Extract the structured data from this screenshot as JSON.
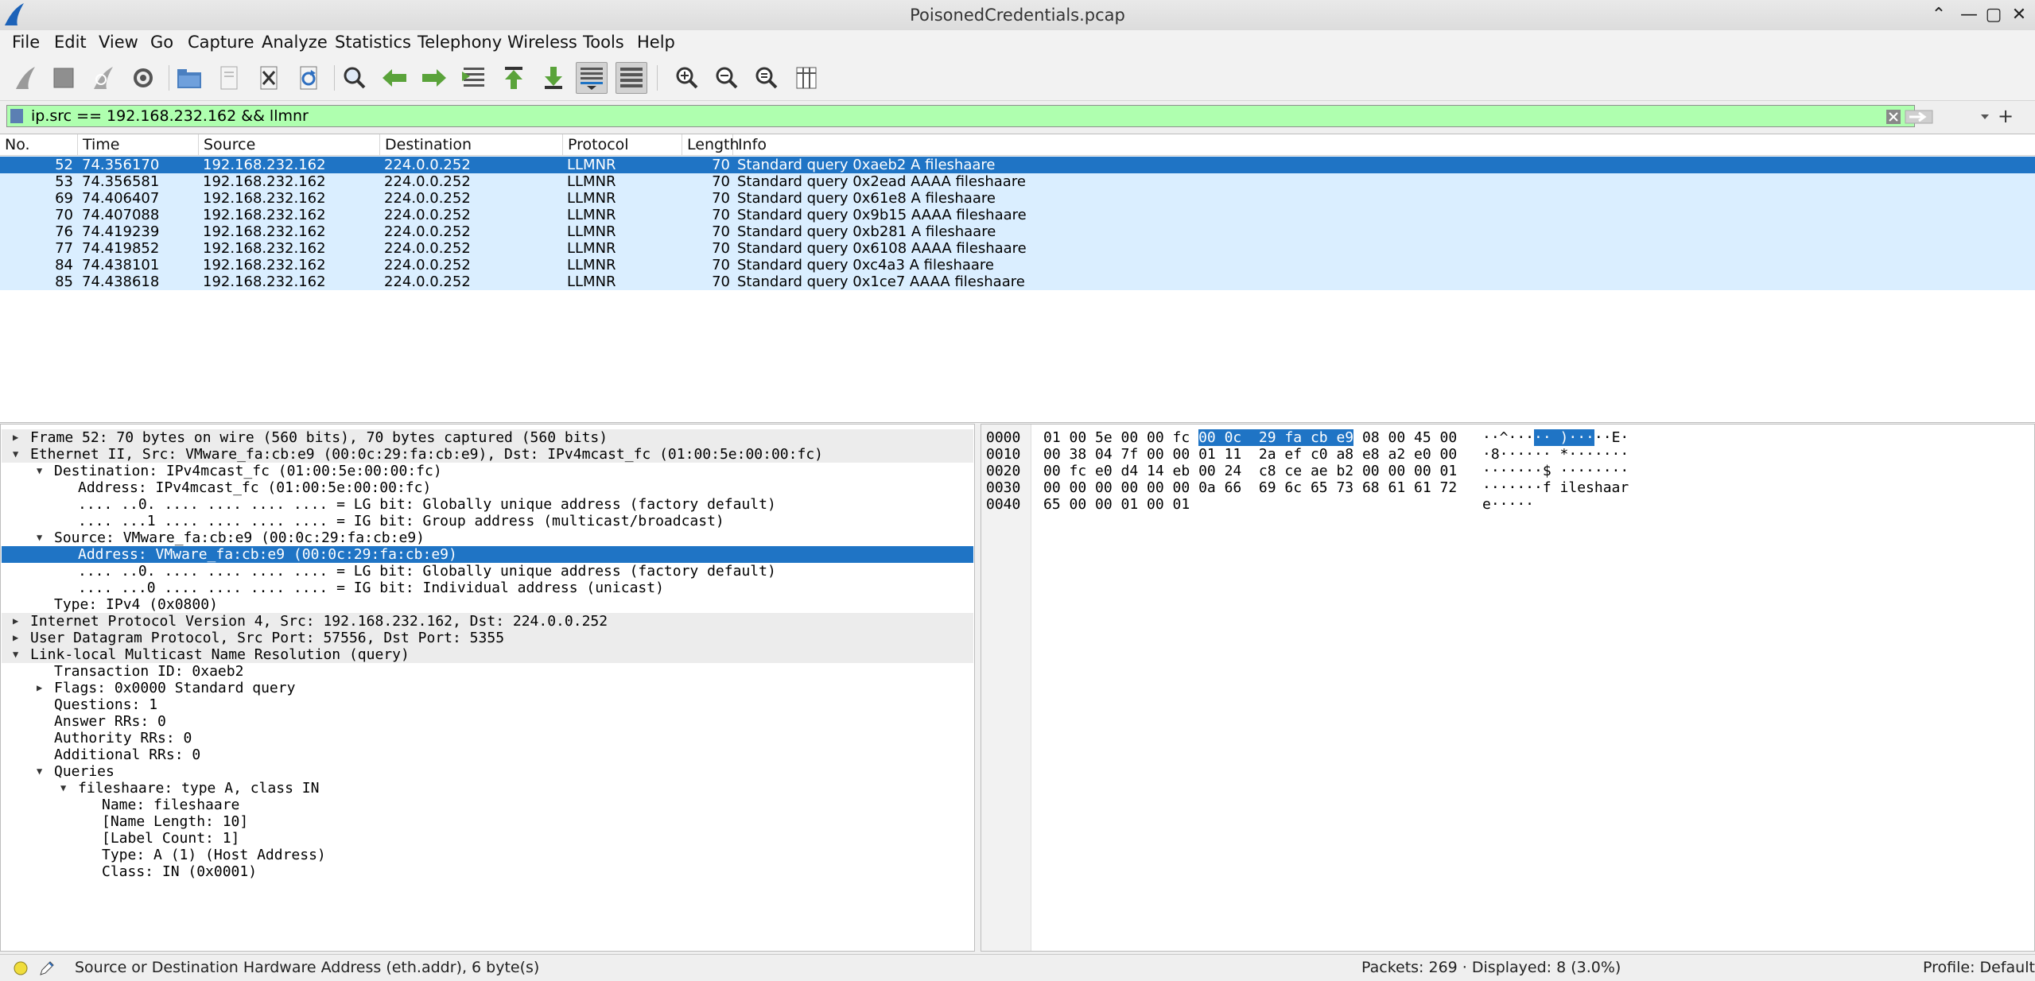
{
  "window": {
    "title": "PoisonedCredentials.pcap",
    "controls": [
      "⌃",
      "—",
      "▢",
      "✕"
    ]
  },
  "menu": [
    "File",
    "Edit",
    "View",
    "Go",
    "Capture",
    "Analyze",
    "Statistics",
    "Telephony",
    "Wireless",
    "Tools",
    "Help"
  ],
  "toolbar": {
    "icons": [
      "shark-fin-start-icon",
      "stop-square-icon",
      "restart-fin-icon",
      "capture-options-gear-icon",
      "open-folder-icon",
      "save-file-icon",
      "close-file-icon",
      "reload-icon",
      "find-magnifier-icon",
      "go-back-arrow-icon",
      "go-forward-arrow-icon",
      "go-to-packet-icon",
      "first-packet-icon",
      "last-packet-icon",
      "autoscroll-icon",
      "colorize-icon",
      "zoom-in-icon",
      "zoom-out-icon",
      "normal-size-icon",
      "resize-columns-icon"
    ]
  },
  "filter": {
    "value": "ip.src == 192.168.232.162 && llmnr",
    "add_label": "+"
  },
  "packet_list": {
    "columns": [
      "No.",
      "Time",
      "Source",
      "Destination",
      "Protocol",
      "Length",
      "Info"
    ],
    "rows": [
      {
        "no": "52",
        "time": "74.356170",
        "src": "192.168.232.162",
        "dst": "224.0.0.252",
        "proto": "LLMNR",
        "len": "70",
        "info": "Standard query 0xaeb2 A fileshaare"
      },
      {
        "no": "53",
        "time": "74.356581",
        "src": "192.168.232.162",
        "dst": "224.0.0.252",
        "proto": "LLMNR",
        "len": "70",
        "info": "Standard query 0x2ead AAAA fileshaare"
      },
      {
        "no": "69",
        "time": "74.406407",
        "src": "192.168.232.162",
        "dst": "224.0.0.252",
        "proto": "LLMNR",
        "len": "70",
        "info": "Standard query 0x61e8 A fileshaare"
      },
      {
        "no": "70",
        "time": "74.407088",
        "src": "192.168.232.162",
        "dst": "224.0.0.252",
        "proto": "LLMNR",
        "len": "70",
        "info": "Standard query 0x9b15 AAAA fileshaare"
      },
      {
        "no": "76",
        "time": "74.419239",
        "src": "192.168.232.162",
        "dst": "224.0.0.252",
        "proto": "LLMNR",
        "len": "70",
        "info": "Standard query 0xb281 A fileshaare"
      },
      {
        "no": "77",
        "time": "74.419852",
        "src": "192.168.232.162",
        "dst": "224.0.0.252",
        "proto": "LLMNR",
        "len": "70",
        "info": "Standard query 0x6108 AAAA fileshaare"
      },
      {
        "no": "84",
        "time": "74.438101",
        "src": "192.168.232.162",
        "dst": "224.0.0.252",
        "proto": "LLMNR",
        "len": "70",
        "info": "Standard query 0xc4a3 A fileshaare"
      },
      {
        "no": "85",
        "time": "74.438618",
        "src": "192.168.232.162",
        "dst": "224.0.0.252",
        "proto": "LLMNR",
        "len": "70",
        "info": "Standard query 0x1ce7 AAAA fileshaare"
      }
    ]
  },
  "details": [
    {
      "level": 0,
      "arrow": "right",
      "text": "Frame 52: 70 bytes on wire (560 bits), 70 bytes captured (560 bits)"
    },
    {
      "level": 0,
      "arrow": "down",
      "text": "Ethernet II, Src: VMware_fa:cb:e9 (00:0c:29:fa:cb:e9), Dst: IPv4mcast_fc (01:00:5e:00:00:fc)"
    },
    {
      "level": 1,
      "arrow": "down",
      "text": "Destination: IPv4mcast_fc (01:00:5e:00:00:fc)"
    },
    {
      "level": 2,
      "arrow": "",
      "text": "Address: IPv4mcast_fc (01:00:5e:00:00:fc)"
    },
    {
      "level": 2,
      "arrow": "",
      "text": ".... ..0. .... .... .... .... = LG bit: Globally unique address (factory default)"
    },
    {
      "level": 2,
      "arrow": "",
      "text": ".... ...1 .... .... .... .... = IG bit: Group address (multicast/broadcast)"
    },
    {
      "level": 1,
      "arrow": "down",
      "text": "Source: VMware_fa:cb:e9 (00:0c:29:fa:cb:e9)"
    },
    {
      "level": 2,
      "arrow": "",
      "text": "Address: VMware_fa:cb:e9 (00:0c:29:fa:cb:e9)",
      "selected": true
    },
    {
      "level": 2,
      "arrow": "",
      "text": ".... ..0. .... .... .... .... = LG bit: Globally unique address (factory default)"
    },
    {
      "level": 2,
      "arrow": "",
      "text": ".... ...0 .... .... .... .... = IG bit: Individual address (unicast)"
    },
    {
      "level": 1,
      "arrow": "",
      "text": "Type: IPv4 (0x0800)"
    },
    {
      "level": 0,
      "arrow": "right",
      "text": "Internet Protocol Version 4, Src: 192.168.232.162, Dst: 224.0.0.252"
    },
    {
      "level": 0,
      "arrow": "right",
      "text": "User Datagram Protocol, Src Port: 57556, Dst Port: 5355"
    },
    {
      "level": 0,
      "arrow": "down",
      "text": "Link-local Multicast Name Resolution (query)"
    },
    {
      "level": 1,
      "arrow": "",
      "text": "Transaction ID: 0xaeb2"
    },
    {
      "level": 1,
      "arrow": "right",
      "text": "Flags: 0x0000 Standard query"
    },
    {
      "level": 1,
      "arrow": "",
      "text": "Questions: 1"
    },
    {
      "level": 1,
      "arrow": "",
      "text": "Answer RRs: 0"
    },
    {
      "level": 1,
      "arrow": "",
      "text": "Authority RRs: 0"
    },
    {
      "level": 1,
      "arrow": "",
      "text": "Additional RRs: 0"
    },
    {
      "level": 1,
      "arrow": "down",
      "text": "Queries"
    },
    {
      "level": 2,
      "arrow": "down",
      "text": "fileshaare: type A, class IN"
    },
    {
      "level": 3,
      "arrow": "",
      "text": "Name: fileshaare"
    },
    {
      "level": 3,
      "arrow": "",
      "text": "[Name Length: 10]"
    },
    {
      "level": 3,
      "arrow": "",
      "text": "[Label Count: 1]"
    },
    {
      "level": 3,
      "arrow": "",
      "text": "Type: A (1) (Host Address)"
    },
    {
      "level": 3,
      "arrow": "",
      "text": "Class: IN (0x0001)"
    }
  ],
  "bytes": [
    {
      "offset": "0000",
      "hex_pre": "01 00 5e 00 00 fc ",
      "hex_hl": "00 0c  29 fa cb e9",
      "hex_post": " 08 00 45 00",
      "ascii_pre": "··^···",
      "ascii_hl": "·· )···",
      "ascii_post": "··E·"
    },
    {
      "offset": "0010",
      "hex_pre": "00 38 04 7f 00 00 01 11  2a ef c0 a8 e8 a2 e0 00",
      "hex_hl": "",
      "hex_post": "",
      "ascii_pre": "·8······ *·······",
      "ascii_hl": "",
      "ascii_post": ""
    },
    {
      "offset": "0020",
      "hex_pre": "00 fc e0 d4 14 eb 00 24  c8 ce ae b2 00 00 00 01",
      "hex_hl": "",
      "hex_post": "",
      "ascii_pre": "·······$ ········",
      "ascii_hl": "",
      "ascii_post": ""
    },
    {
      "offset": "0030",
      "hex_pre": "00 00 00 00 00 00 0a 66  69 6c 65 73 68 61 61 72",
      "hex_hl": "",
      "hex_post": "",
      "ascii_pre": "·······f ileshaar",
      "ascii_hl": "",
      "ascii_post": ""
    },
    {
      "offset": "0040",
      "hex_pre": "65 00 00 01 00 01",
      "hex_hl": "",
      "hex_post": "",
      "ascii_pre": "e·····",
      "ascii_hl": "",
      "ascii_post": ""
    }
  ],
  "status": {
    "field_info": "Source or Destination Hardware Address (eth.addr), 6 byte(s)",
    "packets": "Packets: 269 · Displayed: 8 (3.0%)",
    "profile": "Profile: Default"
  },
  "colors": {
    "selection": "#1f74c5",
    "row_tint": "#daeeff",
    "filter_ok": "#afffaf"
  }
}
